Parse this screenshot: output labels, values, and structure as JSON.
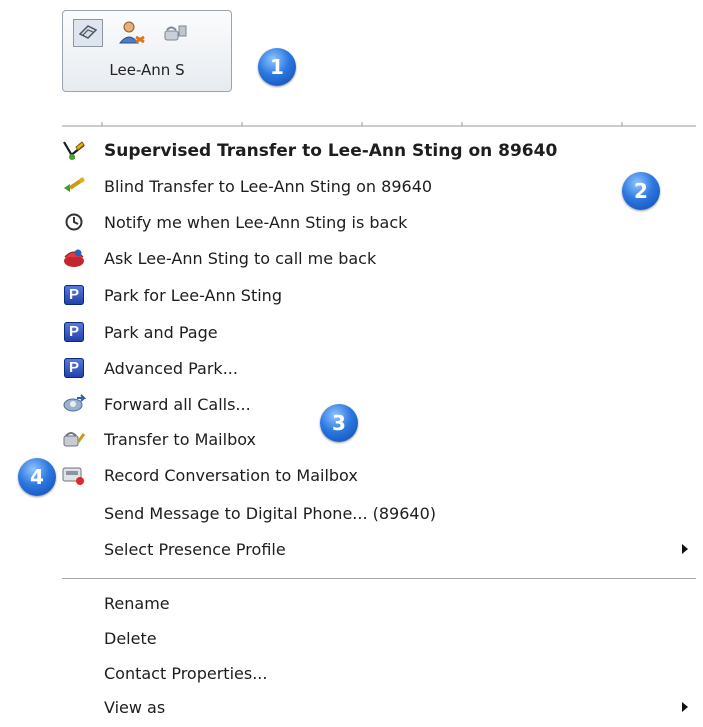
{
  "card": {
    "name": "Lee-Ann S",
    "icons": [
      "presence-status-icon",
      "contact-person-icon",
      "phone-icon"
    ]
  },
  "badges": {
    "b1": "1",
    "b2": "2",
    "b3": "3",
    "b4": "4"
  },
  "menu": {
    "items": [
      {
        "label": "Supervised Transfer to Lee-Ann Sting on 89640",
        "icon": "supervised-transfer-icon"
      },
      {
        "label": "Blind Transfer to Lee-Ann Sting on 89640",
        "icon": "blind-transfer-icon"
      },
      {
        "label": "Notify me when Lee-Ann Sting is back",
        "icon": "clock-icon"
      },
      {
        "label": "Ask Lee-Ann Sting to call me back",
        "icon": "callback-icon"
      },
      {
        "label": "Park for Lee-Ann Sting",
        "icon": "park-icon"
      },
      {
        "label": "Park and Page",
        "icon": "park-icon"
      },
      {
        "label": "Advanced Park...",
        "icon": "park-icon"
      },
      {
        "label": "Forward all Calls...",
        "icon": "forward-icon"
      },
      {
        "label": "Transfer to Mailbox",
        "icon": "mailbox-transfer-icon"
      },
      {
        "label": "Record Conversation to Mailbox",
        "icon": "record-icon"
      },
      {
        "label": "Send Message to Digital Phone... (89640)",
        "icon": ""
      },
      {
        "label": "Select Presence Profile",
        "icon": "",
        "submenu": true
      },
      {
        "label": "Rename",
        "icon": ""
      },
      {
        "label": "Delete",
        "icon": ""
      },
      {
        "label": "Contact Properties...",
        "icon": ""
      },
      {
        "label": "View as",
        "icon": "",
        "submenu": true
      }
    ]
  }
}
